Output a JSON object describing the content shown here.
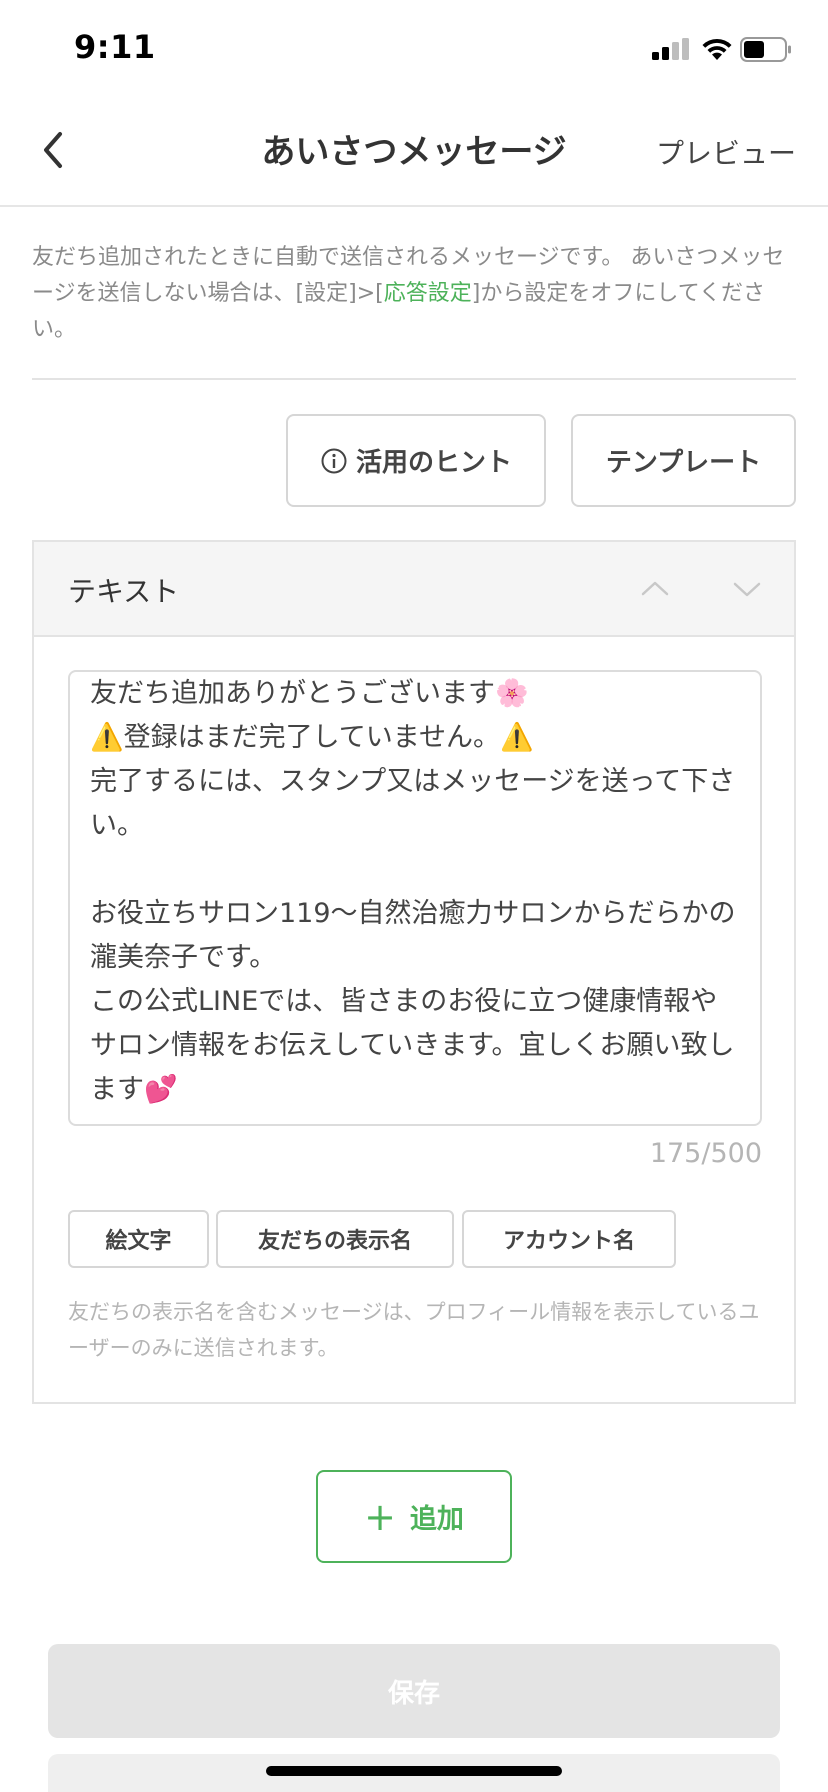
{
  "status_bar": {
    "time": "9:11"
  },
  "nav": {
    "title": "あいさつメッセージ",
    "preview": "プレビュー"
  },
  "description": {
    "before": "友だち追加されたときに自動で送信されるメッセージです。 あいさつメッセージを送信しない場合は、[設定]>[",
    "link": "応答設定",
    "after": "]から設定をオフにしてください。"
  },
  "actions": {
    "hint_label": "活用のヒント",
    "template_label": "テンプレート"
  },
  "card": {
    "title": "テキスト",
    "message": "友だち追加ありがとうございます🌸\n⚠️登録はまだ完了していません。⚠️\n完了するには、スタンプ又はメッセージを送って下さい。\n\nお役立ちサロン119〜自然治癒力サロンからだらかの瀧美奈子です。\nこの公式LINEでは、皆さまのお役に立つ健康情報やサロン情報をお伝えしていきます。宜しくお願い致します💕",
    "counter": "175/500",
    "chips": {
      "emoji": "絵文字",
      "friend_name": "友だちの表示名",
      "account_name": "アカウント名"
    },
    "note": "友だちの表示名を含むメッセージは、プロフィール情報を表示しているユーザーのみに送信されます。"
  },
  "add_button": {
    "label": "追加"
  },
  "save_button": {
    "label": "保存"
  },
  "colors": {
    "accent": "#4db25a",
    "muted_text": "#b5b5b5",
    "border": "#e3e3e3"
  }
}
